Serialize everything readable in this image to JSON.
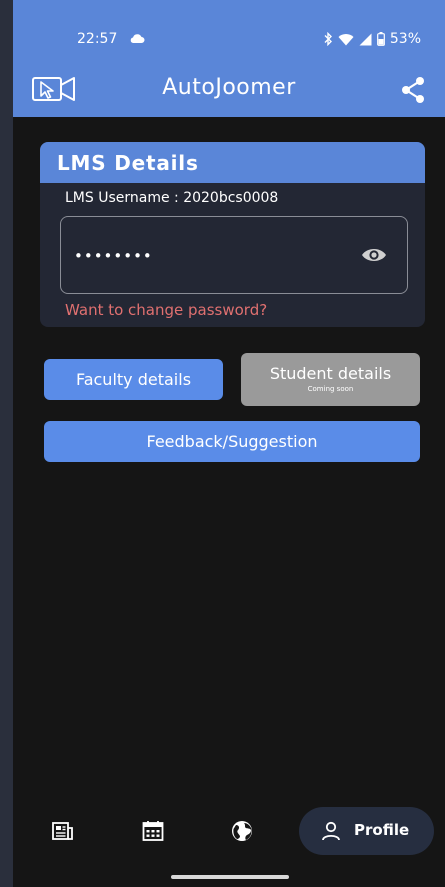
{
  "status_bar": {
    "time": "22:57",
    "battery": "53%",
    "icons": [
      "cloud-icon",
      "bluetooth-icon",
      "wifi-icon",
      "signal-icon",
      "battery-icon"
    ]
  },
  "app_bar": {
    "title": "AutoJoomer",
    "logo_icon": "video-cursor-icon",
    "share_icon": "share-icon",
    "color": "#5a86d8"
  },
  "lms_card": {
    "header": "LMS Details",
    "username_label": "LMS Username : 2020bcs0008",
    "password_value": "••••••••",
    "change_password_link": "Want to change password?",
    "link_color": "#e07070"
  },
  "buttons": {
    "faculty_details": "Faculty details",
    "student_details": "Student details",
    "student_details_sub": "Coming soon",
    "feedback": "Feedback/Suggestion",
    "primary_color": "#5a8ce8",
    "disabled_color": "#9a9a9a"
  },
  "bottom_nav": {
    "items": [
      {
        "icon": "newspaper-icon"
      },
      {
        "icon": "calendar-icon"
      },
      {
        "icon": "globe-icon"
      },
      {
        "icon": "person-icon",
        "label": "Profile",
        "selected": true
      }
    ]
  }
}
